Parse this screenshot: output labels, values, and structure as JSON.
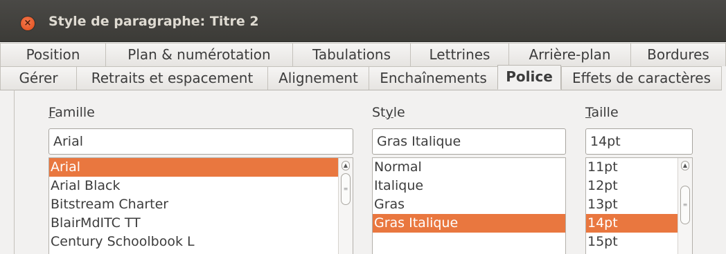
{
  "window": {
    "title": "Style de paragraphe: Titre 2"
  },
  "tabs": {
    "row1": [
      "Position",
      "Plan & numérotation",
      "Tabulations",
      "Lettrines",
      "Arrière-plan",
      "Bordures"
    ],
    "row2": [
      "Gérer",
      "Retraits et espacement",
      "Alignement",
      "Enchaînements",
      "Police",
      "Effets de caractères"
    ],
    "active": "Police"
  },
  "font": {
    "family": {
      "label_mnemonic": "F",
      "label_rest": "amille",
      "value": "Arial",
      "items": [
        "Arial",
        "Arial Black",
        "Bitstream Charter",
        "BlairMdITC TT",
        "Century Schoolbook L"
      ],
      "selected": "Arial"
    },
    "style": {
      "label_pre": "St",
      "label_mnemonic": "y",
      "label_post": "le",
      "value": "Gras Italique",
      "items": [
        "Normal",
        "Italique",
        "Gras",
        "Gras Italique"
      ],
      "selected": "Gras Italique"
    },
    "size": {
      "label_mnemonic": "T",
      "label_rest": "aille",
      "value": "14pt",
      "items": [
        "11pt",
        "12pt",
        "13pt",
        "14pt",
        "15pt"
      ],
      "selected": "14pt"
    }
  },
  "colors": {
    "accent": "#e9773f",
    "titlebar": "#3c3b37"
  }
}
